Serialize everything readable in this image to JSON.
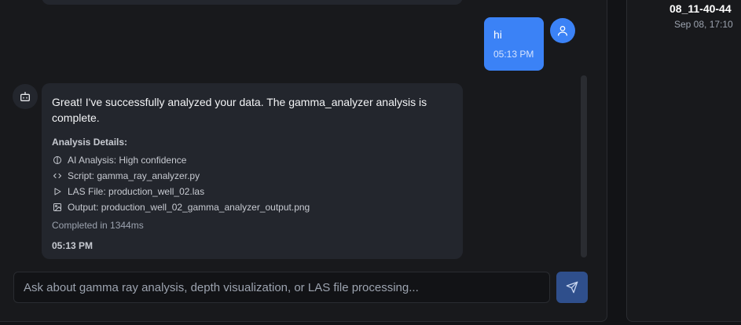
{
  "user_message": {
    "text": "hi",
    "time": "05:13 PM"
  },
  "bot_message": {
    "text": "Great! I've successfully analyzed your data. The gamma_analyzer analysis is complete.",
    "details_title": "Analysis Details:",
    "details": [
      {
        "icon": "brain-icon",
        "label": "AI Analysis: High confidence"
      },
      {
        "icon": "code-icon",
        "label": "Script: gamma_ray_analyzer.py"
      },
      {
        "icon": "play-icon",
        "label": "LAS File: production_well_02.las"
      },
      {
        "icon": "image-icon",
        "label": "Output: production_well_02_gamma_analyzer_output.png"
      }
    ],
    "completed": "Completed in 1344ms",
    "time": "05:13 PM"
  },
  "input": {
    "placeholder": "Ask about gamma ray analysis, depth visualization, or LAS file processing..."
  },
  "side": {
    "title": "08_11-40-44",
    "date": "Sep 08, 17:10"
  },
  "colors": {
    "accent": "#3b82f6",
    "background": "#121316",
    "panel": "#18191c",
    "bubble": "#23262d"
  }
}
